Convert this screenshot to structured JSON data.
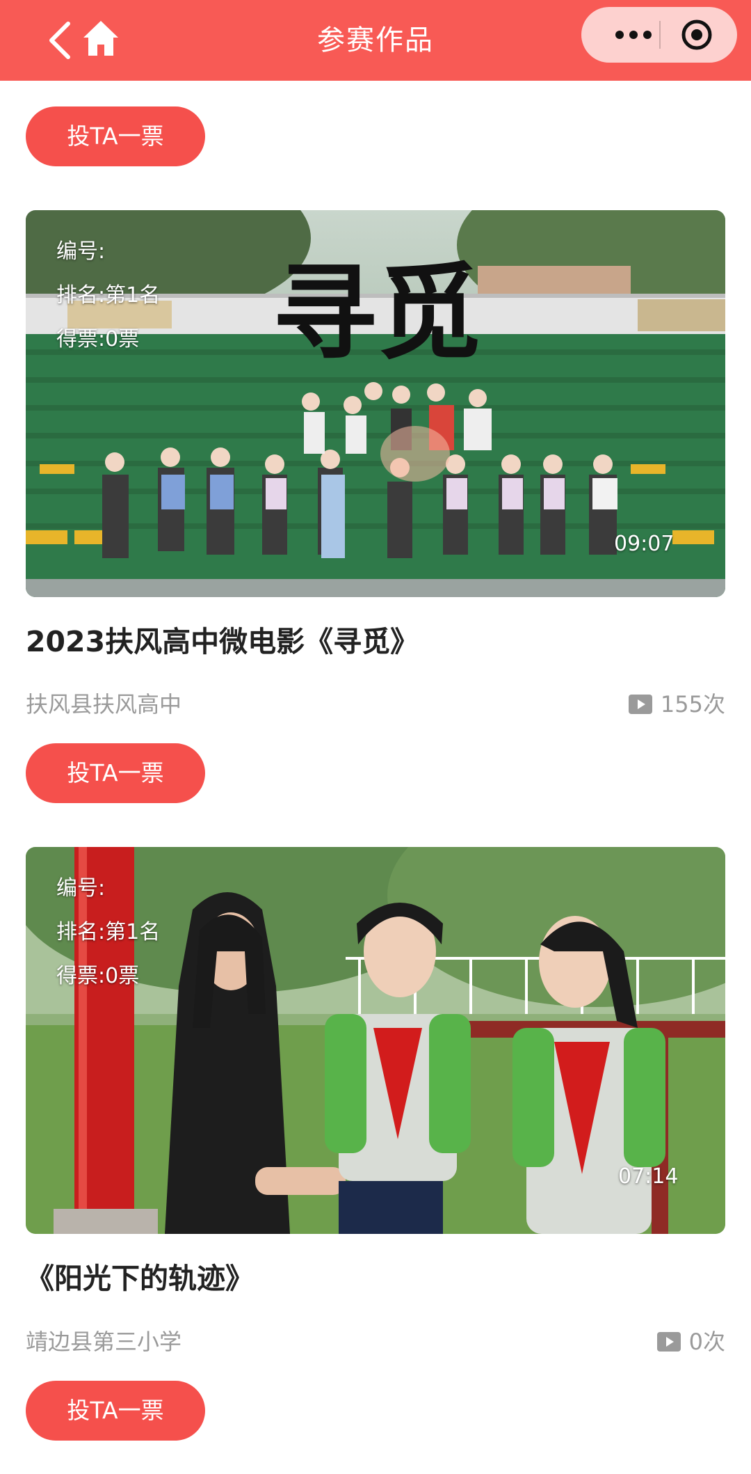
{
  "nav": {
    "title": "参赛作品",
    "color": "#f85a55"
  },
  "vote_button_label": "投TA一票",
  "entries": [
    {
      "number_label": "编号:",
      "rank_label": "排名:第1名",
      "votes_label": "得票:0票",
      "duration": "09:07",
      "title": "2023扶风高中微电影《寻觅》",
      "school": "扶风县扶风高中",
      "views": "155次",
      "poster_text": "寻觅"
    },
    {
      "number_label": "编号:",
      "rank_label": "排名:第1名",
      "votes_label": "得票:0票",
      "duration": "07:14",
      "title": "《阳光下的轨迹》",
      "school": "靖边县第三小学",
      "views": "0次"
    }
  ]
}
